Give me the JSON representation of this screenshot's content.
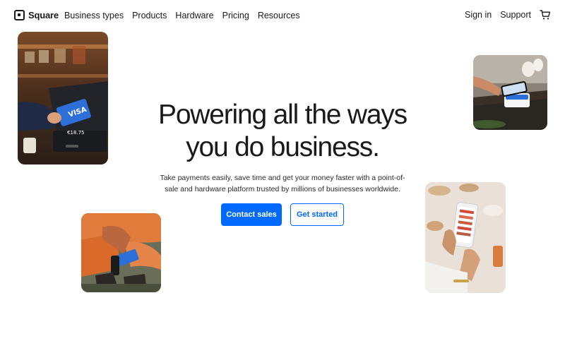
{
  "brand": {
    "name": "Square"
  },
  "nav": {
    "links": [
      "Business types",
      "Products",
      "Hardware",
      "Pricing",
      "Resources"
    ],
    "sign_in": "Sign in",
    "support": "Support",
    "cart_icon": "cart-icon"
  },
  "hero": {
    "headline_line1": "Powering all the ways",
    "headline_line2": "you do business.",
    "subtext": "Take payments easily, save time and get your money faster with a point-of-sale and hardware platform trusted by millions of businesses worldwide."
  },
  "actions": {
    "primary": "Contact sales",
    "secondary": "Get started"
  },
  "photos": {
    "terminal_card_text": "VISA",
    "terminal_amount": "€18.75"
  },
  "colors": {
    "accent": "#006aff",
    "text": "#1a1a1a",
    "background": "#ffffff"
  }
}
